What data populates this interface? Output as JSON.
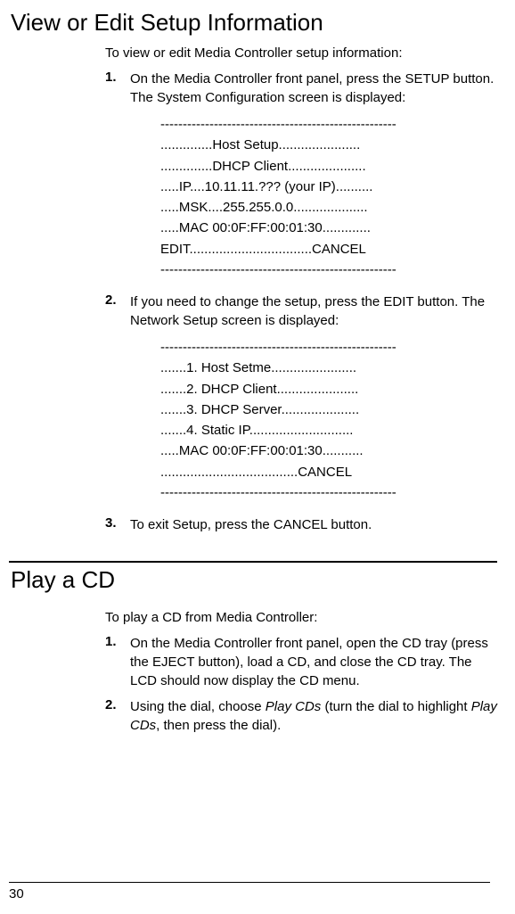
{
  "section1": {
    "heading": "View or Edit Setup Information",
    "intro": "To view or edit Media Controller setup information:",
    "steps": [
      {
        "num": "1.",
        "text": "On the Media Controller front panel, press the SETUP button. The System Configuration screen is displayed:"
      },
      {
        "num": "2.",
        "text": "If you need to change the setup, press the EDIT button. The Network Setup screen is displayed:"
      },
      {
        "num": "3.",
        "text": "To exit Setup, press the CANCEL button."
      }
    ],
    "block1": [
      "-----------------------------------------------------",
      "..............Host Setup......................",
      "..............DHCP Client.....................",
      ".....IP....10.11.11.??? (your IP)..........",
      ".....MSK....255.255.0.0....................",
      ".....MAC 00:0F:FF:00:01:30.............",
      "EDIT.................................CANCEL",
      "-----------------------------------------------------"
    ],
    "block2": [
      "-----------------------------------------------------",
      ".......1. Host Setme.......................",
      ".......2. DHCP Client......................",
      ".......3. DHCP Server.....................",
      ".......4. Static IP............................",
      ".....MAC 00:0F:FF:00:01:30...........",
      ".....................................CANCEL",
      "-----------------------------------------------------"
    ]
  },
  "section2": {
    "heading": "Play a CD",
    "intro": "To play a CD from Media Controller:",
    "steps": [
      {
        "num": "1.",
        "text": "On the Media Controller front panel, open the CD tray (press the EJECT button), load a CD, and close the CD tray. The LCD should now display the CD menu."
      },
      {
        "num": "2.",
        "text_pre": "Using the dial, choose ",
        "text_em1": "Play CDs",
        "text_mid": " (turn the dial to highlight ",
        "text_em2": "Play CDs",
        "text_post": ", then press the dial)."
      }
    ]
  },
  "page_number": "30"
}
